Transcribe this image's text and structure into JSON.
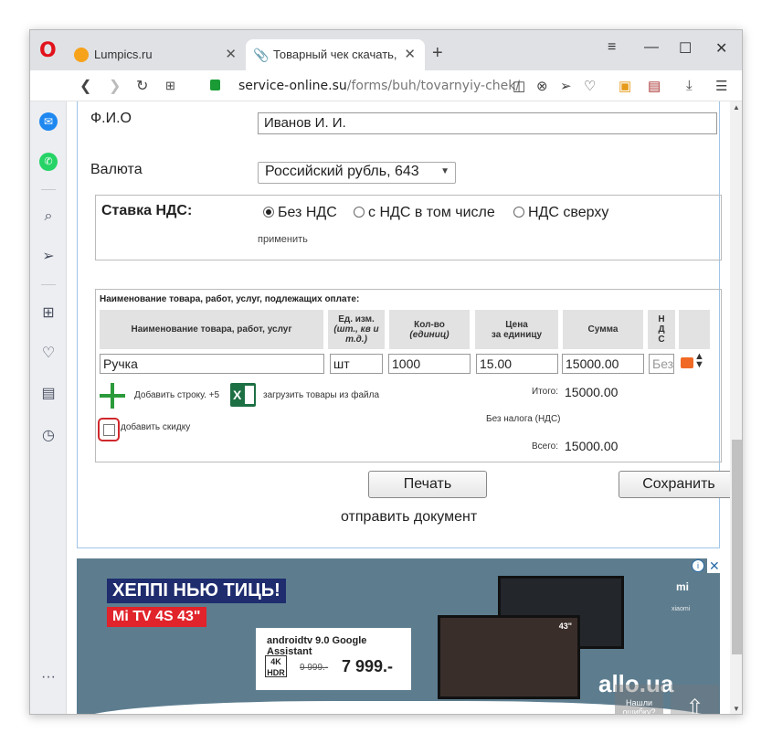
{
  "browser": {
    "tabs": [
      {
        "label": "Lumpics.ru"
      },
      {
        "label": "Товарный чек скачать, ра"
      }
    ],
    "new_tab": "+",
    "url_domain": "service-online.su",
    "url_path": "/forms/buh/tovarnyiy-chek/",
    "opera_logo": "O"
  },
  "form": {
    "fio_label": "Ф.И.О",
    "fio_value": "Иванов И. И.",
    "currency_label": "Валюта",
    "currency_value": "Российский рубль, 643",
    "vat": {
      "title": "Ставка НДС:",
      "options": [
        "Без НДС",
        "с НДС в том числе",
        "НДС сверху"
      ],
      "selected": "Без НДС",
      "apply": "применить"
    },
    "goods": {
      "title": "Наименование товара, работ, услуг, подлежащих оплате:",
      "headers": {
        "name": "Наименование товара, работ, услуг",
        "unit_1": "Ед. изм.",
        "unit_2": "(шт., кв и т.д.)",
        "qty_1": "Кол-во",
        "qty_2": "(единиц)",
        "price_1": "Цена",
        "price_2": "за единицу",
        "sum": "Сумма",
        "nds": "Н Д С"
      },
      "row": {
        "name": "Ручка",
        "unit": "шт",
        "qty": "1000",
        "price": "15.00",
        "sum": "15000.00",
        "nds": "Без"
      },
      "add_row": "Добавить строку. +5",
      "load_file": "загрузить товары из файла",
      "add_discount": "добавить скидку",
      "total_label": "Итого:",
      "total_value": "15000.00",
      "vat_label": "Без налога (НДС)",
      "grand_label": "Всего:",
      "grand_value": "15000.00"
    },
    "print_button": "Печать",
    "save_button": "Сохранить",
    "send_doc": "отправить документ"
  },
  "ad": {
    "headline": "ХЕППІ НЬЮ ТИЦЬ!",
    "product": "Mi TV 4S 43\"",
    "android": "androidtv 9.0 Google Assistant",
    "res_4k": "4K HDR",
    "old_price": "9 999.-",
    "price": "7 999.-",
    "tv_size": "43\"",
    "brand_mi": "mi",
    "brand_xiaomi": "xiaomi",
    "store": "allo.ua",
    "info": "i",
    "close": "✕"
  },
  "overlay": {
    "found_error": "Нашли ошибку?",
    "up": "⇧"
  }
}
